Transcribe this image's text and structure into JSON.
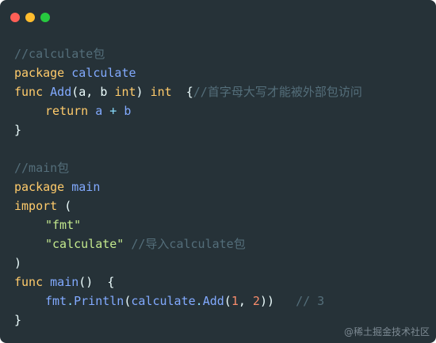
{
  "window": {
    "controls": {
      "close_color": "#ff5f56",
      "minimize_color": "#ffbd2e",
      "maximize_color": "#27c93f"
    }
  },
  "code": {
    "l1_comment": "//calculate包",
    "l2_kw": "package",
    "l2_name": "calculate",
    "l3_kw_func": "func",
    "l3_name": "Add",
    "l3_paren_open": "(",
    "l3_params_a": "a, b",
    "l3_type_int": "int",
    "l3_paren_close": ")",
    "l3_ret_type": "int",
    "l3_brace": "{",
    "l3_comment": "//首字母大写才能被外部包访问",
    "l4_kw_return": "return",
    "l4_expr_a": "a",
    "l4_op_plus": "+",
    "l4_expr_b": "b",
    "l5_brace": "}",
    "l7_comment": "//main包",
    "l8_kw": "package",
    "l8_name": "main",
    "l9_kw": "import",
    "l9_paren": "(",
    "l10_str": "\"fmt\"",
    "l11_str": "\"calculate\"",
    "l11_comment": "//导入calculate包",
    "l12_paren": ")",
    "l13_kw_func": "func",
    "l13_name": "main",
    "l13_parens": "()",
    "l13_brace": "{",
    "l14_obj": "fmt",
    "l14_dot1": ".",
    "l14_fn": "Println",
    "l14_paren_open": "(",
    "l14_obj2": "calculate",
    "l14_dot2": ".",
    "l14_fn2": "Add",
    "l14_paren_open2": "(",
    "l14_arg1": "1",
    "l14_comma": ",",
    "l14_arg2": "2",
    "l14_paren_close2": ")",
    "l14_paren_close": ")",
    "l14_comment": "// 3",
    "l15_brace": "}"
  },
  "watermark": "@稀土掘金技术社区"
}
